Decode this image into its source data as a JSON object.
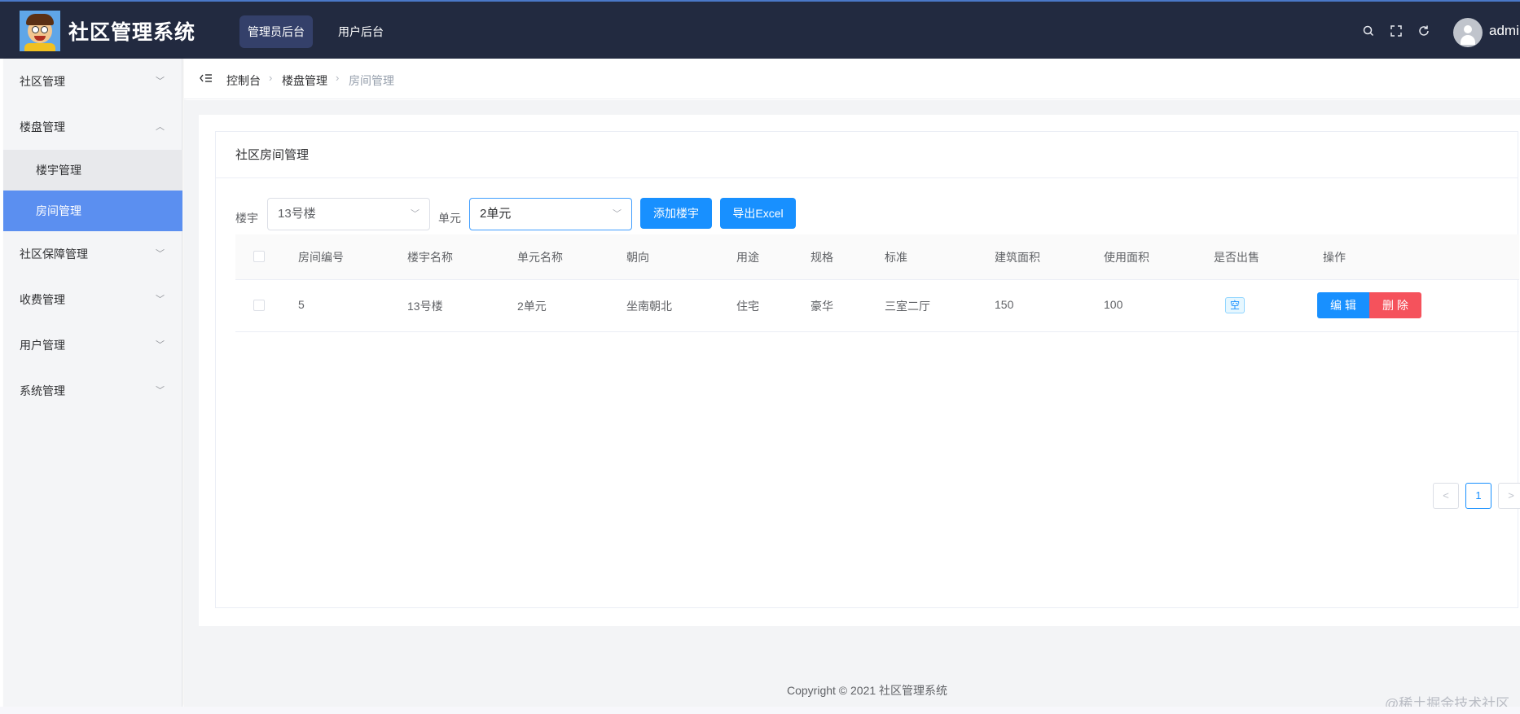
{
  "app": {
    "title": "社区管理系统",
    "user": "admi"
  },
  "topnav": [
    {
      "label": "管理员后台",
      "active": true
    },
    {
      "label": "用户后台",
      "active": false
    }
  ],
  "header_icons": [
    "search-icon",
    "fullscreen-icon",
    "refresh-icon"
  ],
  "sidebar": {
    "items": [
      {
        "label": "社区管理",
        "expanded": false
      },
      {
        "label": "楼盘管理",
        "expanded": true,
        "children": [
          {
            "label": "楼宇管理",
            "active": false
          },
          {
            "label": "房间管理",
            "active": true
          }
        ]
      },
      {
        "label": "社区保障管理",
        "expanded": false
      },
      {
        "label": "收费管理",
        "expanded": false
      },
      {
        "label": "用户管理",
        "expanded": false
      },
      {
        "label": "系统管理",
        "expanded": false
      }
    ]
  },
  "breadcrumb": [
    "控制台",
    "楼盘管理",
    "房间管理"
  ],
  "card": {
    "title": "社区房间管理"
  },
  "filters": {
    "building_label": "楼宇",
    "building_value": "13号楼",
    "unit_label": "单元",
    "unit_value": "2单元",
    "add_button": "添加楼宇",
    "export_button": "导出Excel"
  },
  "table": {
    "columns": [
      "房间编号",
      "楼宇名称",
      "单元名称",
      "朝向",
      "用途",
      "规格",
      "标准",
      "建筑面积",
      "使用面积",
      "是否出售",
      "操作"
    ],
    "rows": [
      {
        "room_no": "5",
        "building": "13号楼",
        "unit": "2单元",
        "orientation": "坐南朝北",
        "usage": "住宅",
        "spec": "豪华",
        "standard": "三室二厅",
        "build_area": "150",
        "use_area": "100",
        "sold": "空",
        "edit": "编 辑",
        "delete": "删 除"
      }
    ]
  },
  "pagination": {
    "prev": "<",
    "current": "1",
    "next": ">"
  },
  "footer": "Copyright © 2021 社区管理系统",
  "watermark": "@稀土掘金技术社区",
  "colors": {
    "header_bg": "#222a40",
    "primary": "#1890ff",
    "danger": "#f5525c",
    "menu_active": "#5b8ff0"
  }
}
